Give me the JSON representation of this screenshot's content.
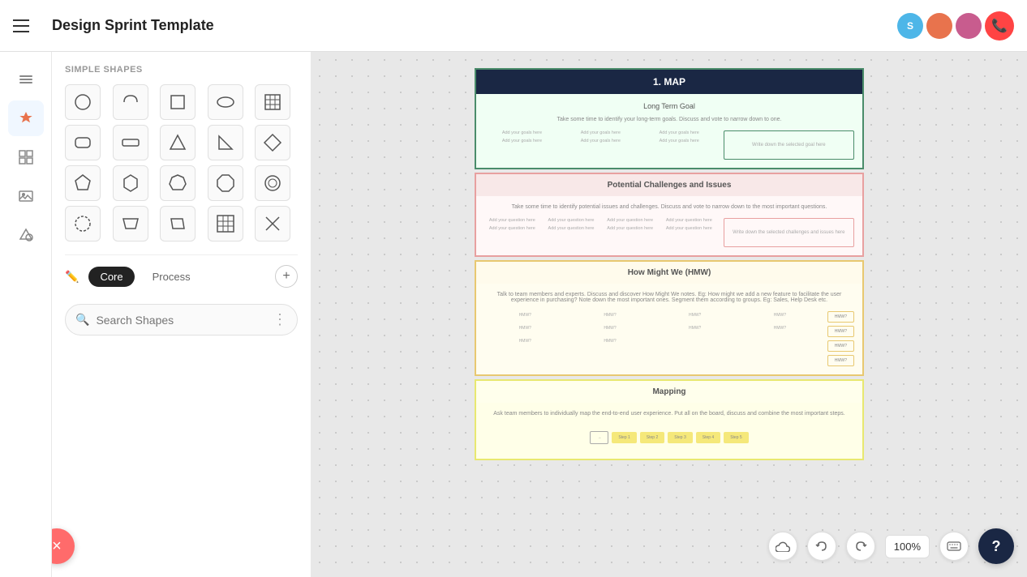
{
  "header": {
    "title": "Design Sprint Template",
    "menu_label": "Menu",
    "avatars": [
      {
        "id": "s",
        "letter": "S",
        "color": "#4db6e8"
      },
      {
        "id": "p",
        "color": "#e8734d"
      },
      {
        "id": "g",
        "color": "#c85c8e"
      }
    ],
    "call_icon": "📞"
  },
  "sidebar": {
    "icons": [
      {
        "name": "menu-icon",
        "symbol": "☰"
      },
      {
        "name": "star-icon",
        "symbol": "⭐"
      },
      {
        "name": "frame-icon",
        "symbol": "⊞"
      },
      {
        "name": "image-icon",
        "symbol": "🖼"
      },
      {
        "name": "shape-icon",
        "symbol": "△"
      }
    ]
  },
  "shapes_panel": {
    "section_title": "SIMPLE SHAPES",
    "shapes": [
      "circle",
      "arc",
      "square",
      "ellipse",
      "table",
      "rounded-rect",
      "wide-rect",
      "triangle",
      "right-triangle",
      "diamond",
      "pentagon",
      "hexagon",
      "heptagon",
      "octagon",
      "circle2",
      "circle3",
      "trapezoid",
      "parallelogram",
      "grid",
      "x"
    ],
    "tabs": {
      "tab_icon": "✏️",
      "items": [
        {
          "label": "Core",
          "active": true
        },
        {
          "label": "Process",
          "active": false
        }
      ],
      "add_label": "+"
    },
    "search": {
      "placeholder": "Search Shapes",
      "more_icon": "⋮"
    }
  },
  "canvas": {
    "sections": [
      {
        "id": "map",
        "header": "1. MAP",
        "header_style": "dark",
        "subsection": "Long Term Goal",
        "sublabel": "Take some time to identify your long-term goals. Discuss and vote to narrow down to one.",
        "goal_cells": [
          "Add your goals here",
          "Add your goals here",
          "Add your goals here",
          "Add your goals here",
          "Add your goals here",
          "Add your goals here"
        ],
        "right_label": "Write down the selected goal here"
      },
      {
        "id": "challenges",
        "header": "Potential Challenges and Issues",
        "sublabel": "Take some time to identify potential issues and challenges. Discuss and vote to narrow down to the most important questions.",
        "q_cells": [
          "Add your question here",
          "Add your question here",
          "Add your question here",
          "Add your question here",
          "Add your question here",
          "Add your question here",
          "Add your question here",
          "Add your question here"
        ],
        "right_label": "Write down the selected challenges and issues here"
      },
      {
        "id": "hmw",
        "header": "How Might We (HMW)",
        "sublabel": "Talk to team members and experts. Discuss and discover How Might We notes. Eg: How might we add a new feature to facilitate the user experience in purchasing? Note down the most important ones. Segment them according to groups. Eg: Sales, Help Desk etc.",
        "cells": [
          "HMW?",
          "HMW?",
          "HMW?",
          "HMW?",
          "HMW?",
          "HMW?",
          "HMW?",
          "HMW?",
          "HMW?",
          "HMW?"
        ],
        "buttons": [
          "HMW?",
          "HMW?",
          "HMW?",
          "HMW?"
        ]
      },
      {
        "id": "mapping",
        "header": "Mapping",
        "sublabel": "Ask team members to individually map the end-to-end user experience. Put all on the board, discuss and combine the most important steps.",
        "flow": [
          "→",
          "Step 1",
          "Step 2",
          "Step 3",
          "Step 4",
          "Step 5"
        ]
      }
    ]
  },
  "bottom_bar": {
    "cloud_icon": "☁",
    "undo_icon": "↩",
    "redo_icon": "↪",
    "zoom": "100%",
    "keyboard_icon": "⌨",
    "help_label": "?"
  },
  "fab": {
    "close_icon": "×"
  }
}
